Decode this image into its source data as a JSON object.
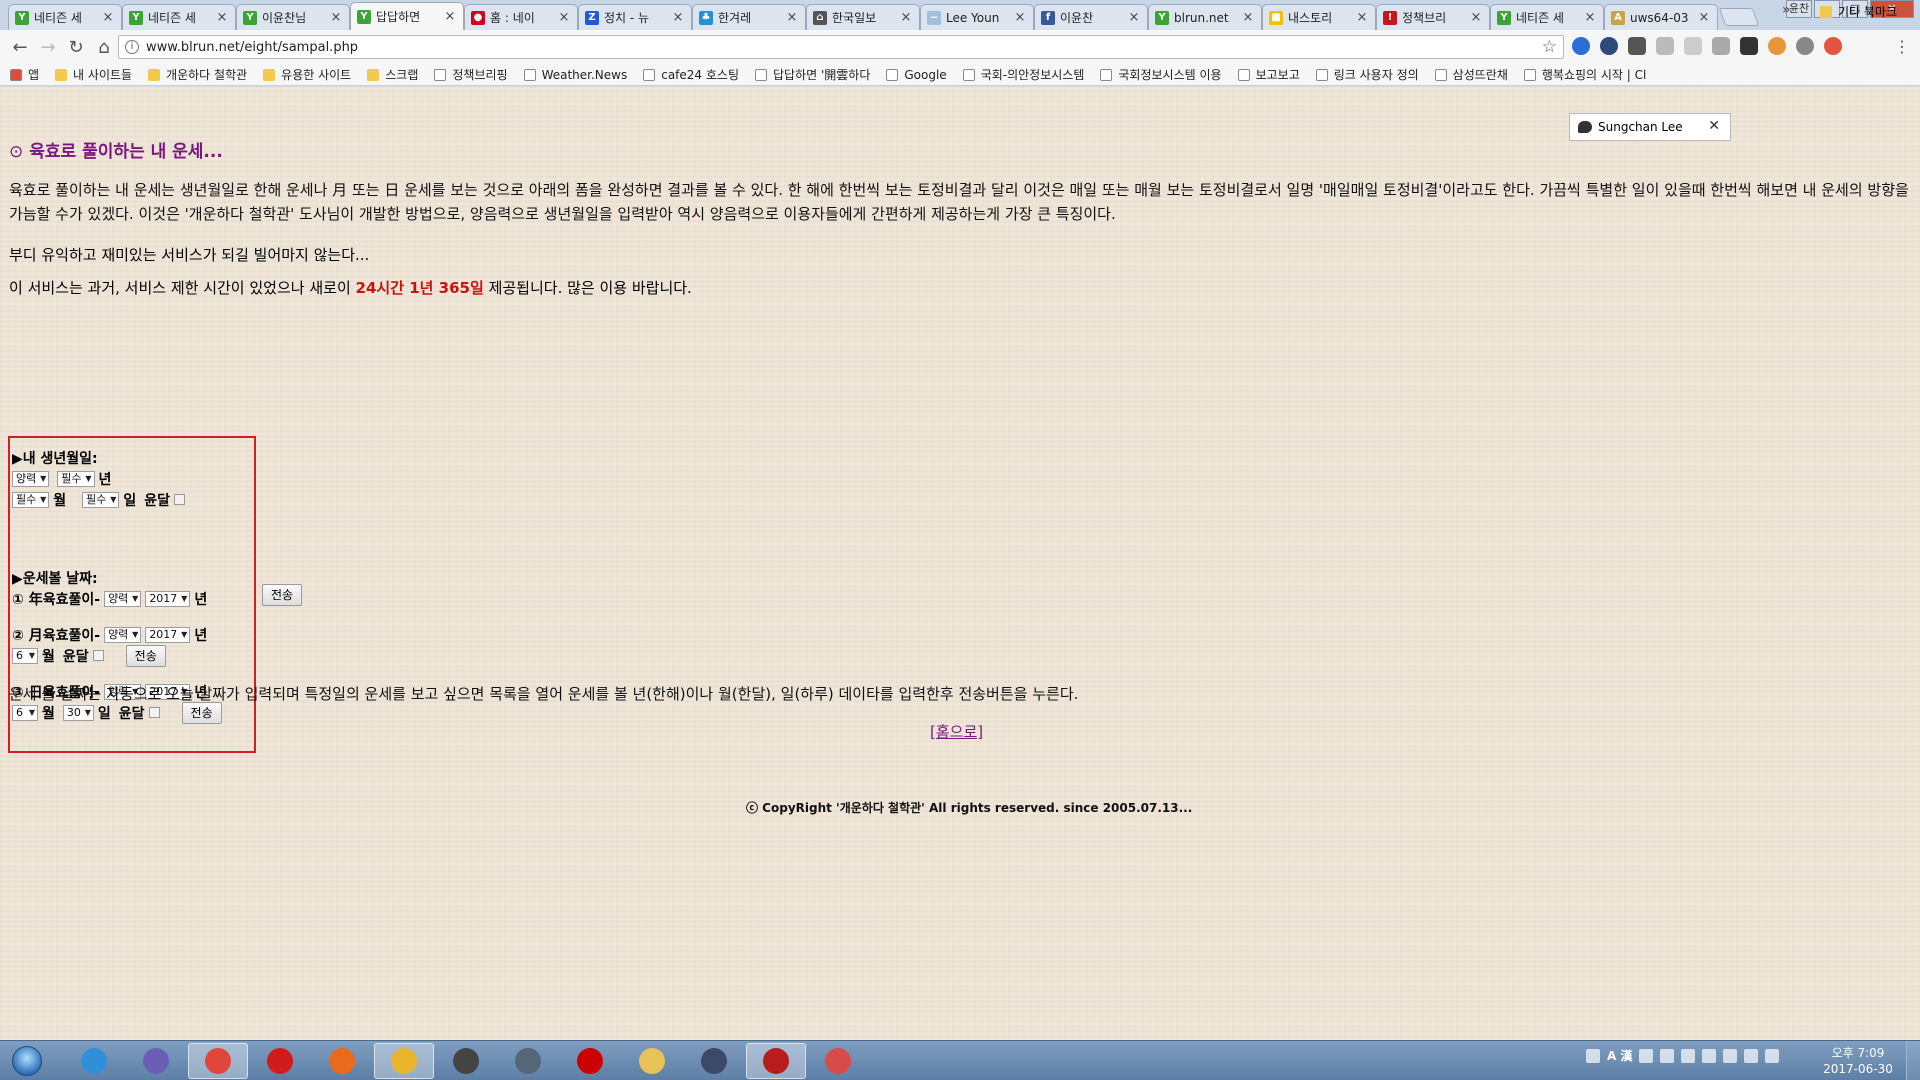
{
  "browser": {
    "tabs": [
      {
        "label": "네티즌 세",
        "color": "#3aa535",
        "glyph": "Y"
      },
      {
        "label": "네티즌 세",
        "color": "#3aa535",
        "glyph": "Y"
      },
      {
        "label": "이윤찬님",
        "color": "#3aa535",
        "glyph": "Y"
      },
      {
        "label": "답답하면",
        "color": "#3aa535",
        "glyph": "Y",
        "active": true
      },
      {
        "label": "홈 : 네이",
        "color": "#d0021b",
        "glyph": "●"
      },
      {
        "label": "정치 - 뉴",
        "color": "#1e5bd6",
        "glyph": "Z"
      },
      {
        "label": "한겨레",
        "color": "#2a8fd9",
        "glyph": "♣"
      },
      {
        "label": "한국일보",
        "color": "#555555",
        "glyph": "⌂"
      },
      {
        "label": "Lee Youn",
        "color": "#9fc0de",
        "glyph": "~"
      },
      {
        "label": "이윤찬",
        "color": "#3b5998",
        "glyph": "f"
      },
      {
        "label": "blrun.net",
        "color": "#3aa535",
        "glyph": "Y"
      },
      {
        "label": "내스토리",
        "color": "#f2c200",
        "glyph": "■"
      },
      {
        "label": "정책브리",
        "color": "#c4161c",
        "glyph": "!"
      },
      {
        "label": "네티즌 세",
        "color": "#3aa535",
        "glyph": "Y"
      },
      {
        "label": "uws64-03",
        "color": "#c9a24a",
        "glyph": "A"
      }
    ],
    "window_controls": {
      "user": "윤찬",
      "minimize": "–",
      "maximize": "□",
      "close": "✕"
    },
    "url": "www.blrun.net/eight/sampal.php",
    "bookmarks": [
      {
        "label": "앱",
        "type": "apps"
      },
      {
        "label": "내 사이트들",
        "type": "folder"
      },
      {
        "label": "개운하다 철학관",
        "type": "folder"
      },
      {
        "label": "유용한 사이트",
        "type": "folder"
      },
      {
        "label": "스크랩",
        "type": "folder"
      },
      {
        "label": "정책브리핑",
        "type": "page"
      },
      {
        "label": "Weather.News",
        "type": "page"
      },
      {
        "label": "cafe24 호스팅",
        "type": "page"
      },
      {
        "label": "답답하면 '開雲하다",
        "type": "page"
      },
      {
        "label": "Google",
        "type": "page"
      },
      {
        "label": "국회-의안정보시스템",
        "type": "page"
      },
      {
        "label": "국회정보시스템 이용",
        "type": "page"
      },
      {
        "label": "보고보고",
        "type": "page"
      },
      {
        "label": "링크 사용자 정의",
        "type": "page"
      },
      {
        "label": "삼성뜨란채",
        "type": "page"
      },
      {
        "label": "행복쇼핑의 시작 | Cl",
        "type": "page"
      }
    ],
    "bookmarks_more": "»",
    "other_bookmarks": "기타 북마크"
  },
  "page": {
    "title": "육효로 풀이하는 내 운세...",
    "title_icon": "⊙",
    "intro": "육효로 풀이하는 내 운세는 생년월일로 한해 운세나 月 또는 日 운세를 보는 것으로 아래의 폼을 완성하면 결과를 볼 수 있다. 한 해에 한번씩 보는 토정비결과 달리 이것은 매일 또는 매월 보는 토정비결로서 일명 '매일매일 토정비결'이라고도 한다. 가끔씩 특별한 일이 있을때 한번씩 해보면 내 운세의 방향을 가늠할 수가 있겠다. 이것은 '개운하다 철학관' 도사님이 개발한 방법으로, 양음력으로 생년월일을 입력받아 역시 양음력으로 이용자들에게 간편하게 제공하는게 가장 큰 특징이다.",
    "wish": "부디 유익하고 재미있는 서비스가 되길 빌어마지 않는다...",
    "service_pre": "이 서비스는 과거, 서비스 제한 시간이 있었으나 새로이 ",
    "service_highlight": "24시간 1년 365일",
    "service_post": " 제공됩니다. 많은 이용 바랍니다.",
    "form": {
      "birth_label": "▶내 생년월일:",
      "birth_calendar": "양력",
      "birth_year": "필수",
      "year_unit": "년",
      "birth_month": "필수",
      "month_unit": "월",
      "birth_day": "필수",
      "day_unit": "일",
      "leap_label": "윤달",
      "fortune_label": "▶운세볼 날짜:",
      "year_fortune": {
        "label": "① 年육효풀이-",
        "calendar": "양력",
        "year": "2017",
        "year_unit": "년",
        "submit": "전송"
      },
      "month_fortune": {
        "label": "② 月육효풀이-",
        "calendar": "양력",
        "year": "2017",
        "year_unit": "년",
        "month": "6",
        "month_unit": "월",
        "leap_label": "윤달",
        "submit": "전송"
      },
      "day_fortune": {
        "label": "③ 日육효풀이-",
        "calendar": "양력",
        "year": "2017",
        "year_unit": "년",
        "month": "6",
        "month_unit": "월",
        "day": "30",
        "day_unit": "일",
        "leap_label": "윤달",
        "submit": "전송"
      }
    },
    "note": "운세 볼 날짜는 자동으로 오늘 날짜가 입력되며 특정일의 운세를 보고 싶으면 목록을 열어 운세를 볼 년(한해)이나 월(한달), 일(하루) 데이타를 입력한후 전송버튼을 누른다.",
    "home_link": "[홈으로]",
    "copyright": "ⓒ CopyRight '개운하다 철학관' All rights reserved. since 2005.07.13..."
  },
  "chat": {
    "name": "Sungchan Lee",
    "close": "✕"
  },
  "taskbar": {
    "apps": [
      {
        "name": "internet-explorer",
        "color": "#2f8fd8"
      },
      {
        "name": "browser-s",
        "color": "#6a5fb5"
      },
      {
        "name": "chrome",
        "color": "#e0463a",
        "active": true
      },
      {
        "name": "opera",
        "color": "#d21c1c"
      },
      {
        "name": "firefox",
        "color": "#e86a1a"
      },
      {
        "name": "pen-tool",
        "color": "#e8b52c",
        "active": true
      },
      {
        "name": "eye-app",
        "color": "#444444"
      },
      {
        "name": "book-app",
        "color": "#556677"
      },
      {
        "name": "record-app",
        "color": "#cc0000"
      },
      {
        "name": "explorer",
        "color": "#e7c35a"
      },
      {
        "name": "globe-app",
        "color": "#3b4a66"
      },
      {
        "name": "filezilla",
        "color": "#b81c1c",
        "active": true
      },
      {
        "name": "eraser-app",
        "color": "#d84b4b"
      }
    ],
    "ime": "A 漢",
    "clock_time": "오후 7:09",
    "clock_date": "2017-06-30"
  }
}
